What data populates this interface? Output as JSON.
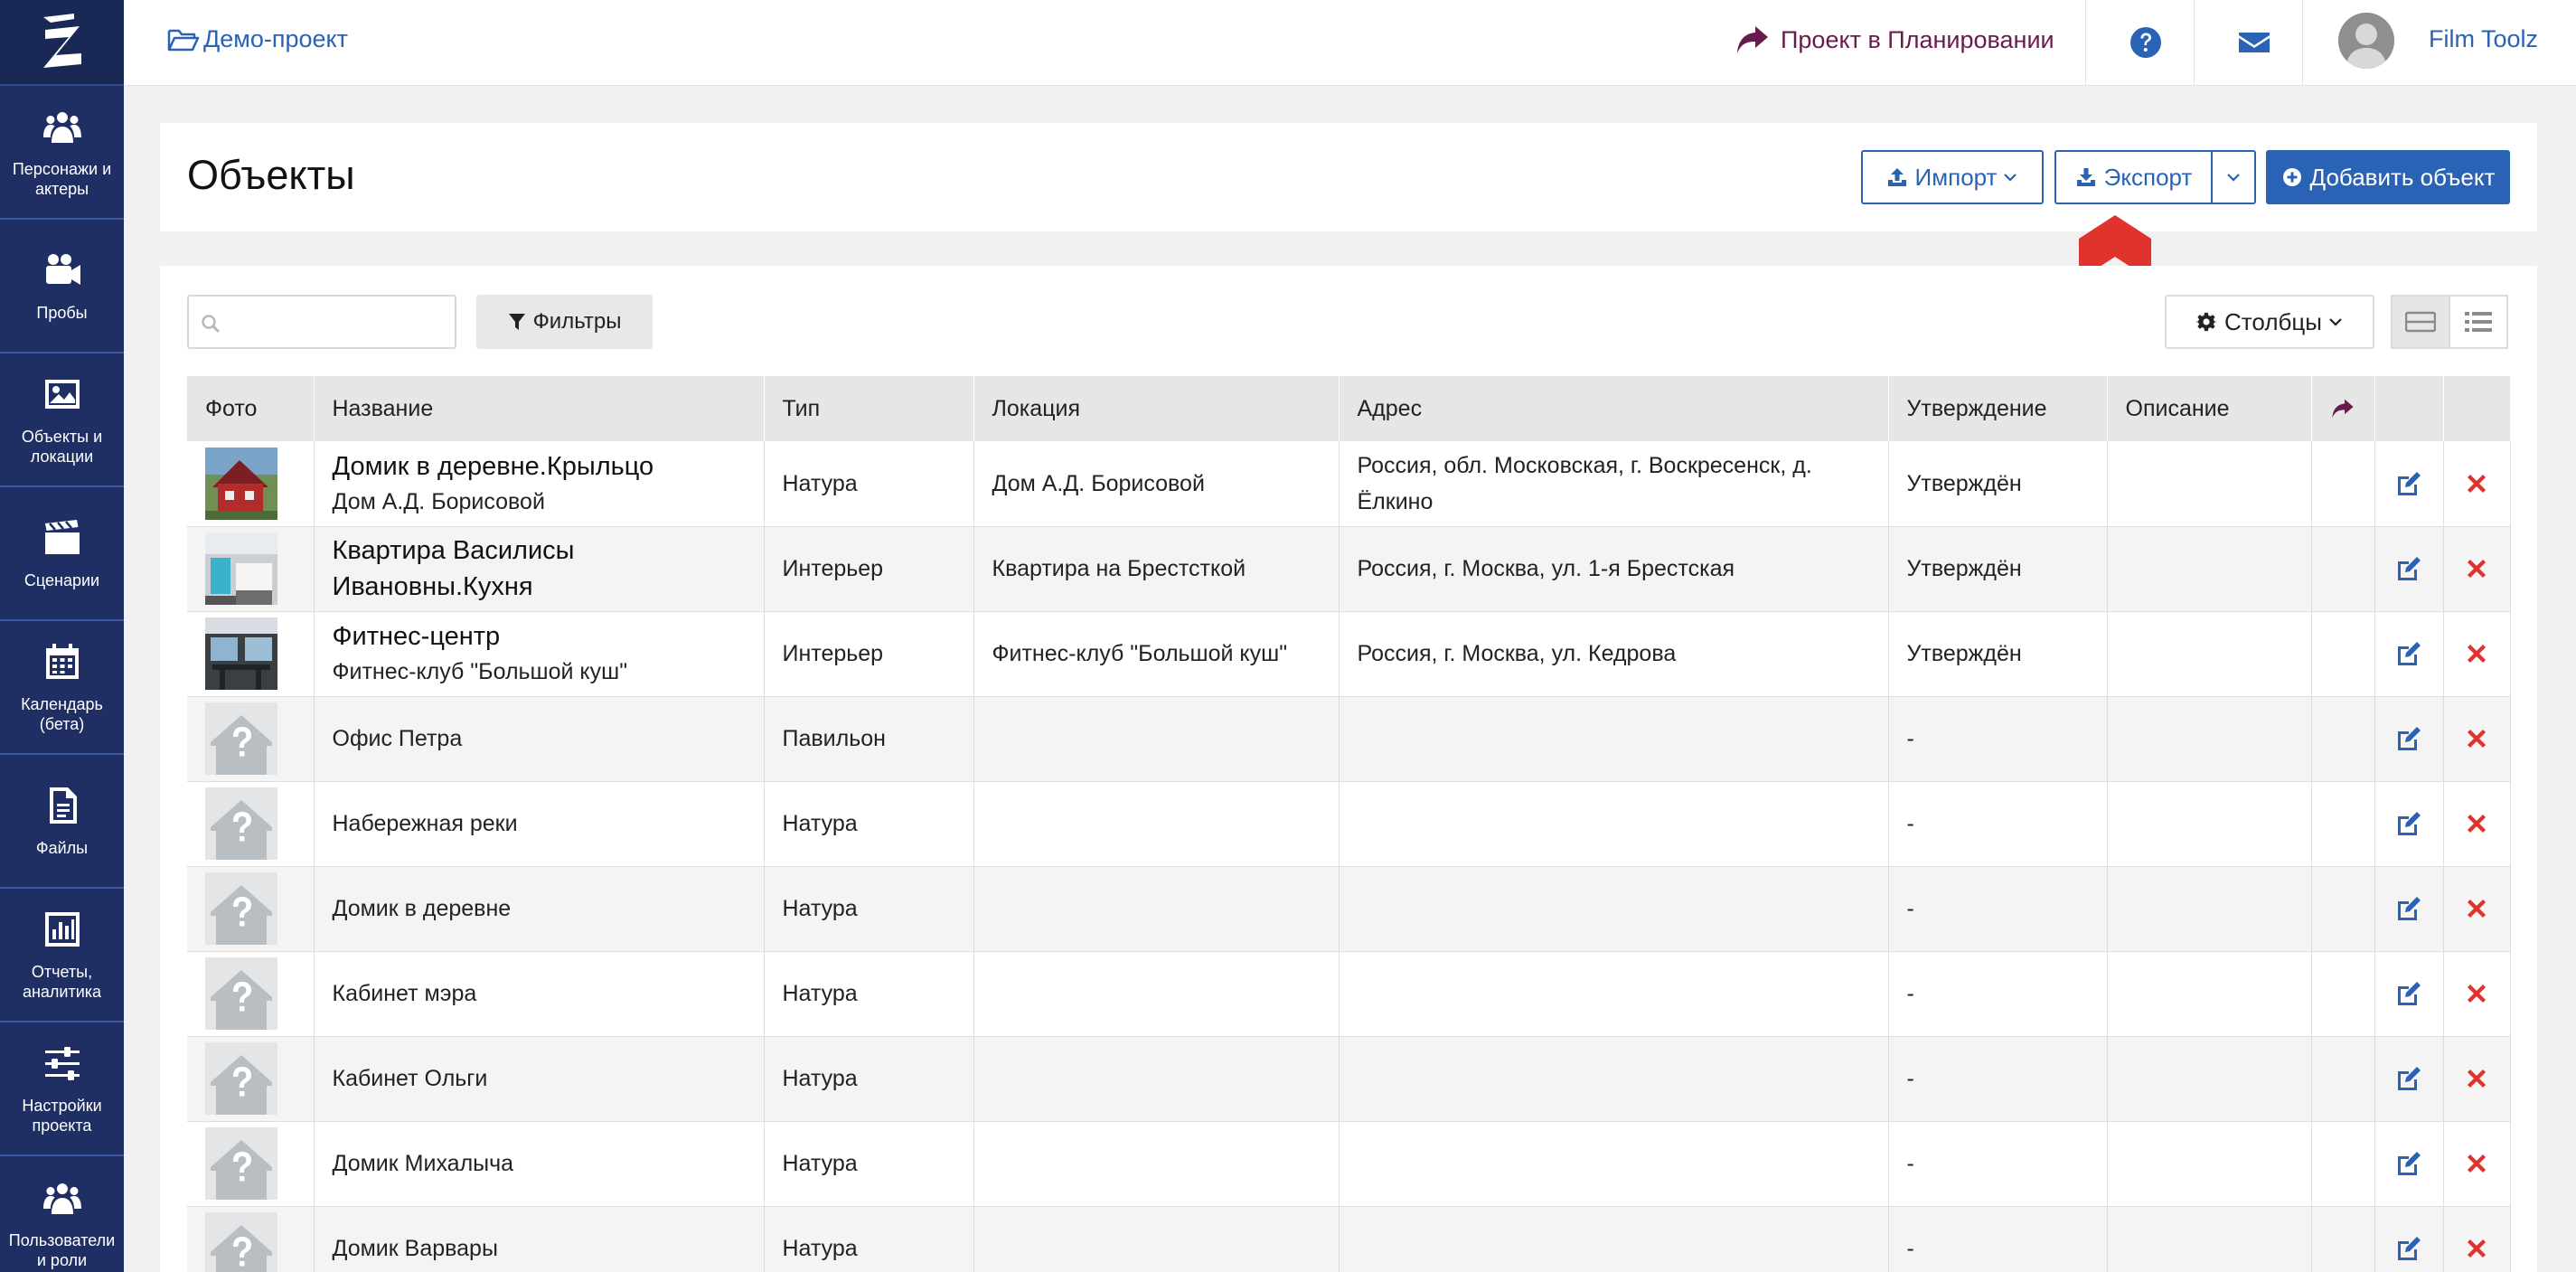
{
  "brand": {
    "accent": "#2a63b6",
    "sidebar_bg": "#1f2f63",
    "danger": "#e0332e",
    "plan_color": "#6a1b4d"
  },
  "sidebar": {
    "items": [
      {
        "label": "Персонажи и актеры",
        "icon": "users-icon"
      },
      {
        "label": "Пробы",
        "icon": "video-camera-icon"
      },
      {
        "label": "Объекты и локации",
        "icon": "image-icon"
      },
      {
        "label": "Сценарии",
        "icon": "clapperboard-icon"
      },
      {
        "label": "Календарь (бета)",
        "icon": "calendar-icon"
      },
      {
        "label": "Файлы",
        "icon": "file-icon"
      },
      {
        "label": "Отчеты, аналитика",
        "icon": "bar-chart-icon"
      },
      {
        "label": "Настройки проекта",
        "icon": "sliders-icon"
      },
      {
        "label": "Пользователи и роли",
        "icon": "users-icon"
      }
    ]
  },
  "topbar": {
    "project": "Демо-проект",
    "planning": "Проект в Планировании",
    "user": "Film Toolz"
  },
  "header": {
    "title": "Объекты",
    "import_label": "Импорт",
    "export_label": "Экспорт",
    "add_label": "Добавить объект"
  },
  "toolbar": {
    "search_placeholder": "",
    "filters_label": "Фильтры",
    "columns_label": "Столбцы"
  },
  "table": {
    "columns": [
      "Фото",
      "Название",
      "Тип",
      "Локация",
      "Адрес",
      "Утверждение",
      "Описание"
    ],
    "rows": [
      {
        "photo": "house-photo",
        "name": "Домик в деревне.Крыльцо",
        "subname": "Дом А.Д. Борисовой",
        "type": "Натура",
        "location": "Дом А.Д. Борисовой",
        "address": "Россия, обл. Московская, г. Воскресенск, д. Ёлкино",
        "approval": "Утверждён",
        "description": ""
      },
      {
        "photo": "kitchen-photo",
        "name": "Квартира Василисы Ивановны.Кухня",
        "subname": "",
        "type": "Интерьер",
        "location": "Квартира на Брестсткой",
        "address": "Россия, г. Москва, ул. 1-я Брестская",
        "approval": "Утверждён",
        "description": ""
      },
      {
        "photo": "gym-photo",
        "name": "Фитнес-центр",
        "subname": "Фитнес-клуб \"Большой куш\"",
        "type": "Интерьер",
        "location": "Фитнес-клуб \"Большой куш\"",
        "address": "Россия, г. Москва, ул. Кедрова",
        "approval": "Утверждён",
        "description": ""
      },
      {
        "photo": "placeholder",
        "name": "Офис Петра",
        "subname": "",
        "type": "Павильон",
        "location": "",
        "address": "",
        "approval": "-",
        "description": ""
      },
      {
        "photo": "placeholder",
        "name": "Набережная реки",
        "subname": "",
        "type": "Натура",
        "location": "",
        "address": "",
        "approval": "-",
        "description": ""
      },
      {
        "photo": "placeholder",
        "name": "Домик в деревне",
        "subname": "",
        "type": "Натура",
        "location": "",
        "address": "",
        "approval": "-",
        "description": ""
      },
      {
        "photo": "placeholder",
        "name": "Кабинет мэра",
        "subname": "",
        "type": "Натура",
        "location": "",
        "address": "",
        "approval": "-",
        "description": ""
      },
      {
        "photo": "placeholder",
        "name": "Кабинет Ольги",
        "subname": "",
        "type": "Натура",
        "location": "",
        "address": "",
        "approval": "-",
        "description": ""
      },
      {
        "photo": "placeholder",
        "name": "Домик Михалыча",
        "subname": "",
        "type": "Натура",
        "location": "",
        "address": "",
        "approval": "-",
        "description": ""
      },
      {
        "photo": "placeholder",
        "name": "Домик Варвары",
        "subname": "",
        "type": "Натура",
        "location": "",
        "address": "",
        "approval": "-",
        "description": ""
      }
    ]
  }
}
